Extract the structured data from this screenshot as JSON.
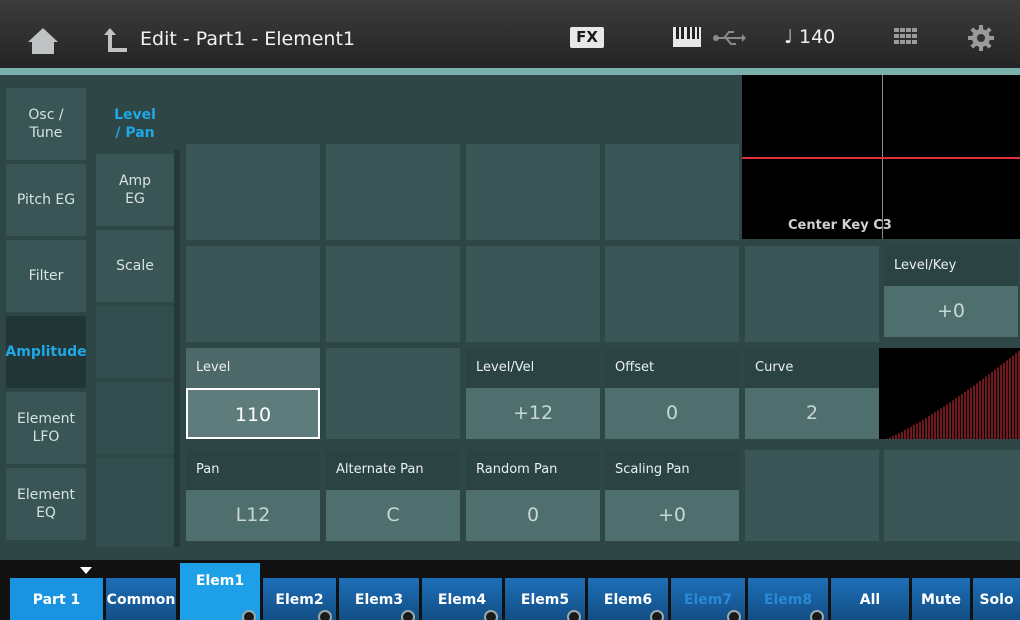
{
  "header": {
    "title": "Edit - Part1 - Element1",
    "fx_label": "FX",
    "tempo": "♩ 140"
  },
  "nav_primary": [
    {
      "label": "Osc /\nTune",
      "active": false
    },
    {
      "label": "Pitch EG",
      "active": false
    },
    {
      "label": "Filter",
      "active": false
    },
    {
      "label": "Amplitude",
      "active": true
    },
    {
      "label": "Element\nLFO",
      "active": false
    },
    {
      "label": "Element\nEQ",
      "active": false
    }
  ],
  "nav_secondary": [
    {
      "label": "Level\n/ Pan",
      "active": true
    },
    {
      "label": "Amp\nEG",
      "active": false
    },
    {
      "label": "Scale",
      "active": false
    }
  ],
  "graph": {
    "center_key_label": "Center Key C3"
  },
  "params": {
    "level_key": {
      "label": "Level/Key",
      "value": "+0"
    },
    "level": {
      "label": "Level",
      "value": "110"
    },
    "level_vel": {
      "label": "Level/Vel",
      "value": "+12"
    },
    "offset": {
      "label": "Offset",
      "value": "0"
    },
    "curve": {
      "label": "Curve",
      "value": "2"
    },
    "pan": {
      "label": "Pan",
      "value": "L12"
    },
    "alternate_pan": {
      "label": "Alternate Pan",
      "value": "C"
    },
    "random_pan": {
      "label": "Random Pan",
      "value": "0"
    },
    "scaling_pan": {
      "label": "Scaling Pan",
      "value": "+0"
    }
  },
  "tabs": [
    {
      "label": "Part 1"
    },
    {
      "label": "Common"
    },
    {
      "label": "Elem1"
    },
    {
      "label": "Elem2"
    },
    {
      "label": "Elem3"
    },
    {
      "label": "Elem4"
    },
    {
      "label": "Elem5"
    },
    {
      "label": "Elem6"
    },
    {
      "label": "Elem7"
    },
    {
      "label": "Elem8"
    },
    {
      "label": "All"
    },
    {
      "label": "Mute"
    },
    {
      "label": "Solo"
    }
  ],
  "colors": {
    "accent": "#1ea8e6",
    "curve_line": "#e0303a"
  }
}
